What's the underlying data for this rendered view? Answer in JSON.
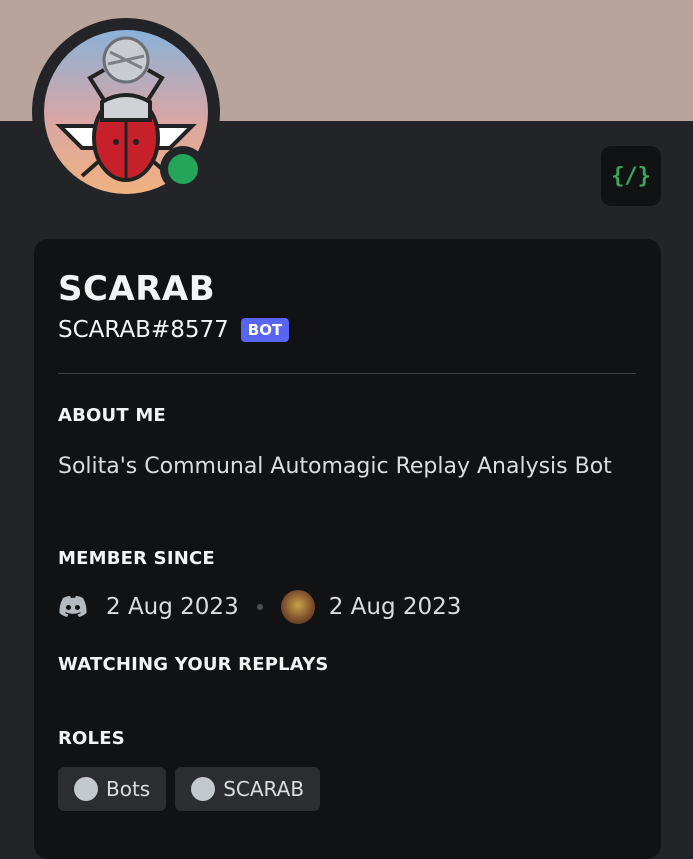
{
  "profile": {
    "display_name": "SCARAB",
    "username": "SCARAB#8577",
    "bot_tag": "BOT",
    "dev_badge": "{/}",
    "banner_color": "#b9a49c",
    "status": "online",
    "status_color": "#23a55a"
  },
  "about": {
    "title": "ABOUT ME",
    "text": "Solita's Communal Automagic Replay Analysis Bot"
  },
  "member_since": {
    "title": "MEMBER SINCE",
    "discord_icon": "discord-logo-icon",
    "discord_date": "2 Aug 2023",
    "server_icon": "server-icon",
    "server_date": "2 Aug 2023"
  },
  "activity": {
    "title": "WATCHING YOUR REPLAYS"
  },
  "roles": {
    "title": "ROLES",
    "items": [
      {
        "label": "Bots",
        "color": "#c4c9ce"
      },
      {
        "label": "SCARAB",
        "color": "#c4c9ce"
      }
    ]
  }
}
